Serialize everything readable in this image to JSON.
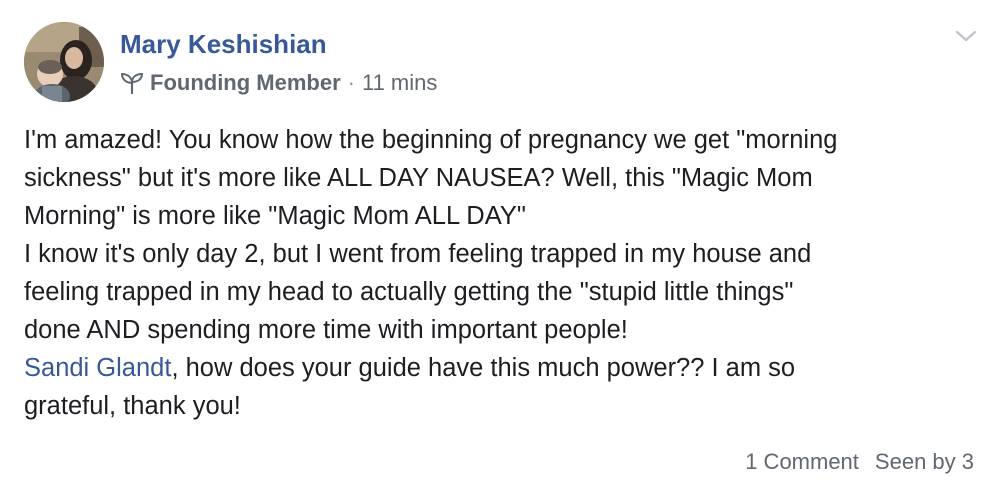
{
  "post": {
    "author": {
      "name": "Mary Keshishian"
    },
    "badge": {
      "label": "Founding Member",
      "icon": "sprout-icon"
    },
    "separator": "·",
    "timestamp": "11 mins",
    "menu_icon": "chevron-down-icon",
    "body": {
      "paragraph1": {
        "line1": "I'm amazed! You know how the beginning of pregnancy we get \"morning",
        "line2": "sickness\" but it's more like ALL DAY NAUSEA? Well, this \"Magic Mom",
        "line3": "Morning\" is more like \"Magic Mom ALL DAY\""
      },
      "paragraph2": {
        "line1": "I know it's only day 2, but I went from feeling trapped in my house and",
        "line2": "feeling trapped in my head to actually getting the \"stupid little things\"",
        "line3": "done AND spending more time with important people!"
      },
      "paragraph3": {
        "mention": "Sandi Glandt",
        "line1_rest": ", how does your guide have this much power?? I am so",
        "line2": "grateful, thank you!"
      }
    },
    "footer": {
      "comments": "1 Comment",
      "seen_by": "Seen by 3"
    }
  },
  "colors": {
    "link_blue": "#385898",
    "text": "#1c1e21",
    "meta_gray": "#616770"
  }
}
